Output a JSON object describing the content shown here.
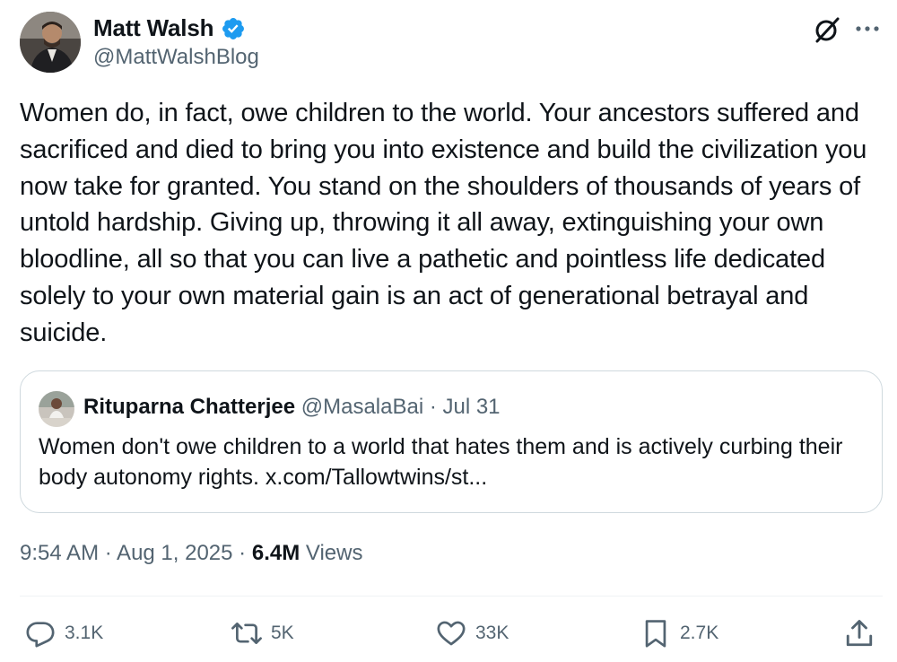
{
  "author": {
    "display_name": "Matt Walsh",
    "handle": "@MattWalshBlog",
    "verified": true
  },
  "tweet": {
    "text": "Women do, in fact, owe children to the world. Your ancestors suffered and sacrificed and died to bring you into existence and build the civilization you now take for granted. You stand on the shoulders of thousands of years of untold hardship. Giving up, throwing it all away, extinguishing your own bloodline, all so that you can live a pathetic and pointless life dedicated solely to your own material gain is an act of generational betrayal and suicide."
  },
  "quote": {
    "display_name": "Rituparna Chatterjee",
    "meta": "@MasalaBai · Jul 31",
    "text": "Women don't owe children to a world that hates them and is actively curbing their body autonomy rights. x.com/Tallowtwins/st..."
  },
  "meta": {
    "time_date": "9:54 AM · Aug 1, 2025 · ",
    "views_count": "6.4M",
    "views_label": " Views"
  },
  "actions": {
    "replies": "3.1K",
    "reposts": "5K",
    "likes": "33K",
    "bookmarks": "2.7K"
  },
  "icons": {
    "verified": "verified-badge-icon",
    "grok": "grok-icon",
    "more": "more-dots-icon",
    "reply": "reply-icon",
    "repost": "repost-icon",
    "like": "heart-icon",
    "bookmark": "bookmark-icon",
    "share": "share-icon"
  },
  "colors": {
    "verified_blue": "#1d9bf0",
    "secondary_text": "#536471",
    "primary_text": "#0f1419",
    "border": "#cfd9de"
  }
}
